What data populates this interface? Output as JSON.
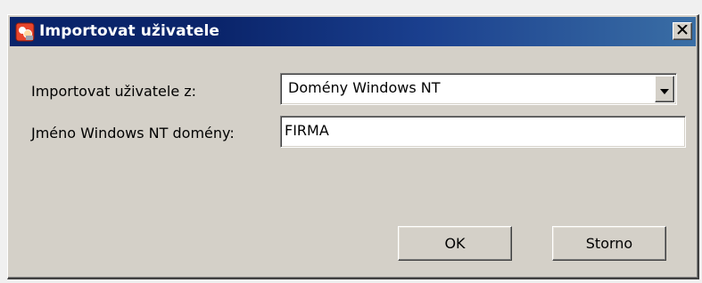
{
  "window": {
    "title": "Importovat uživatele",
    "app_icon": "app-icon",
    "close_icon": "close-icon"
  },
  "form": {
    "import_from_label": "Importovat uživatele z:",
    "import_from_value": "Domény Windows NT",
    "domain_name_label": "Jméno Windows NT domény:",
    "domain_name_value": "FIRMA"
  },
  "buttons": {
    "ok_label": "OK",
    "cancel_label": "Storno"
  },
  "colors": {
    "titlebar": "#0a246a",
    "dialog_bg": "#d4d0c8"
  }
}
